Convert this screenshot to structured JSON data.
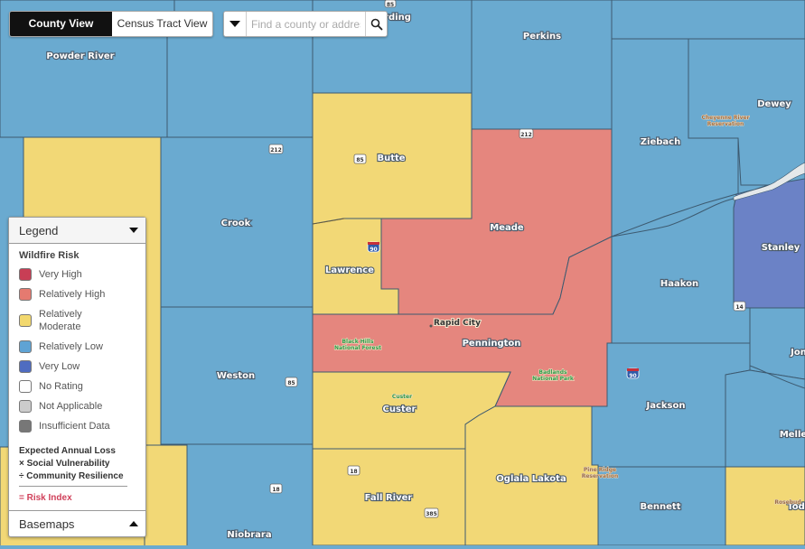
{
  "view_toggle": {
    "county_view": "County View",
    "census_tract_view": "Census Tract View",
    "active": "County View"
  },
  "search": {
    "placeholder": "Find a county or address",
    "value": ""
  },
  "legend": {
    "title": "Legend",
    "subtitle": "Wildfire Risk",
    "items": [
      {
        "label": "Very High",
        "color": "#c83e55"
      },
      {
        "label": "Relatively High",
        "color": "#e57a70"
      },
      {
        "label": "Relatively Moderate",
        "color": "#f2d86e"
      },
      {
        "label": "Relatively Low",
        "color": "#5fa3d4"
      },
      {
        "label": "Very Low",
        "color": "#4f6cc0"
      },
      {
        "label": "No Rating",
        "color": "#ffffff"
      },
      {
        "label": "Not Applicable",
        "color": "#cccccc"
      },
      {
        "label": "Insufficient Data",
        "color": "#777777"
      }
    ],
    "formula": {
      "line1": "Expected Annual Loss",
      "line2": "× Social Vulnerability",
      "line3": "÷ Community Resilience",
      "result": "= Risk Index"
    },
    "basemaps": "Basemaps"
  },
  "map": {
    "colors": {
      "relatively_high": "#e5867e",
      "relatively_moderate": "#f2d876",
      "relatively_low": "#6aaad0",
      "very_low": "#6b82c6",
      "water": "#e4e8ea"
    },
    "counties": [
      {
        "name": "Powder River",
        "risk": "Relatively Low"
      },
      {
        "name": "Harding",
        "label": "rding",
        "risk": "Relatively Low"
      },
      {
        "name": "Perkins",
        "risk": "Relatively Low"
      },
      {
        "name": "Dewey",
        "risk": "Relatively Low"
      },
      {
        "name": "Ziebach",
        "risk": "Relatively Low"
      },
      {
        "name": "Butte",
        "risk": "Relatively Moderate"
      },
      {
        "name": "Crook",
        "risk": "Relatively Low"
      },
      {
        "name": "Meade",
        "risk": "Relatively High"
      },
      {
        "name": "Lawrence",
        "risk": "Relatively Moderate"
      },
      {
        "name": "Stanley",
        "risk": "Very Low"
      },
      {
        "name": "Haakon",
        "risk": "Relatively Low"
      },
      {
        "name": "Pennington",
        "risk": "Relatively High"
      },
      {
        "name": "Weston",
        "risk": "Relatively Low"
      },
      {
        "name": "Jones",
        "label": "Jon",
        "risk": "Relatively Low"
      },
      {
        "name": "Jackson",
        "risk": "Relatively Low"
      },
      {
        "name": "Custer",
        "risk": "Relatively Moderate"
      },
      {
        "name": "Mellette",
        "label": "Melle",
        "risk": "Relatively Low"
      },
      {
        "name": "Fall River",
        "risk": "Relatively Moderate"
      },
      {
        "name": "Oglala Lakota",
        "risk": "Relatively Moderate"
      },
      {
        "name": "Bennett",
        "risk": "Relatively Low"
      },
      {
        "name": "Todd",
        "label": "Tod",
        "risk": "Relatively Moderate"
      },
      {
        "name": "Niobrara",
        "risk": "Relatively Low"
      }
    ],
    "places": {
      "rapid_city": "Rapid City",
      "custer_town": "Custer"
    },
    "parks": {
      "black_hills_1": "Black Hills",
      "black_hills_2": "National Forest",
      "badlands_1": "Badlands",
      "badlands_2": "National Park"
    },
    "reservations": {
      "cheyenne_1": "Cheyenne River",
      "cheyenne_2": "Reservation",
      "pine_ridge_1": "Pine Ridge",
      "pine_ridge_2": "Reservation",
      "rosebud": "Rosebud"
    },
    "highways": {
      "us85_top": "85",
      "us85_butte": "85",
      "us212_crook": "212",
      "us212_meade": "212",
      "i90_lawrence": "90",
      "i90_jackson": "90",
      "us85_weston": "85",
      "us18_niobrara": "18",
      "us18_fallriver": "18",
      "us385": "385",
      "us14": "14"
    }
  }
}
